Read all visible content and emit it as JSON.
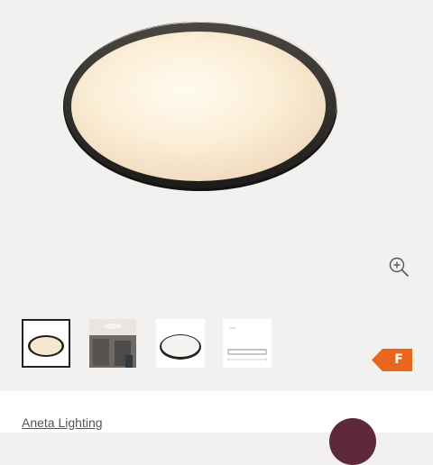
{
  "product": {
    "brand": "Aneta Lighting",
    "energy_class": "F",
    "main_image": "ceiling-lamp-round-black-rim",
    "zoom_icon": "zoom-in-icon",
    "thumbnails": [
      {
        "name": "thumb-lamp-front",
        "selected": true
      },
      {
        "name": "thumb-room-installed",
        "selected": false
      },
      {
        "name": "thumb-lamp-white-background",
        "selected": false
      },
      {
        "name": "thumb-dimension-drawing",
        "selected": false
      }
    ]
  },
  "colors": {
    "background": "#f2f1ef",
    "energy_badge": "#e8671d",
    "accent": "#5e2a3a"
  }
}
